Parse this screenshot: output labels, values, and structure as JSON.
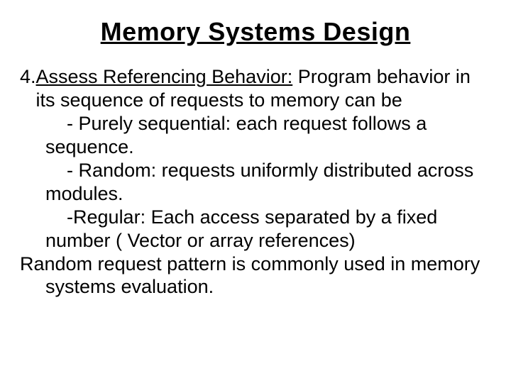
{
  "title": "Memory Systems Design",
  "item_number": "4. ",
  "lede": "Assess Referencing Behavior:",
  "lede_tail": " Program behavior in its sequence of requests to memory can be",
  "bullets": [
    {
      "marker": "- ",
      "text": "Purely sequential: each request follows a sequence."
    },
    {
      "marker": "- ",
      "text": "Random: requests uniformly distributed across modules."
    },
    {
      "marker": "-",
      "text": "Regular: Each access separated by a fixed number ( Vector or array references)"
    }
  ],
  "closing": "Random request pattern is commonly used in memory systems evaluation."
}
